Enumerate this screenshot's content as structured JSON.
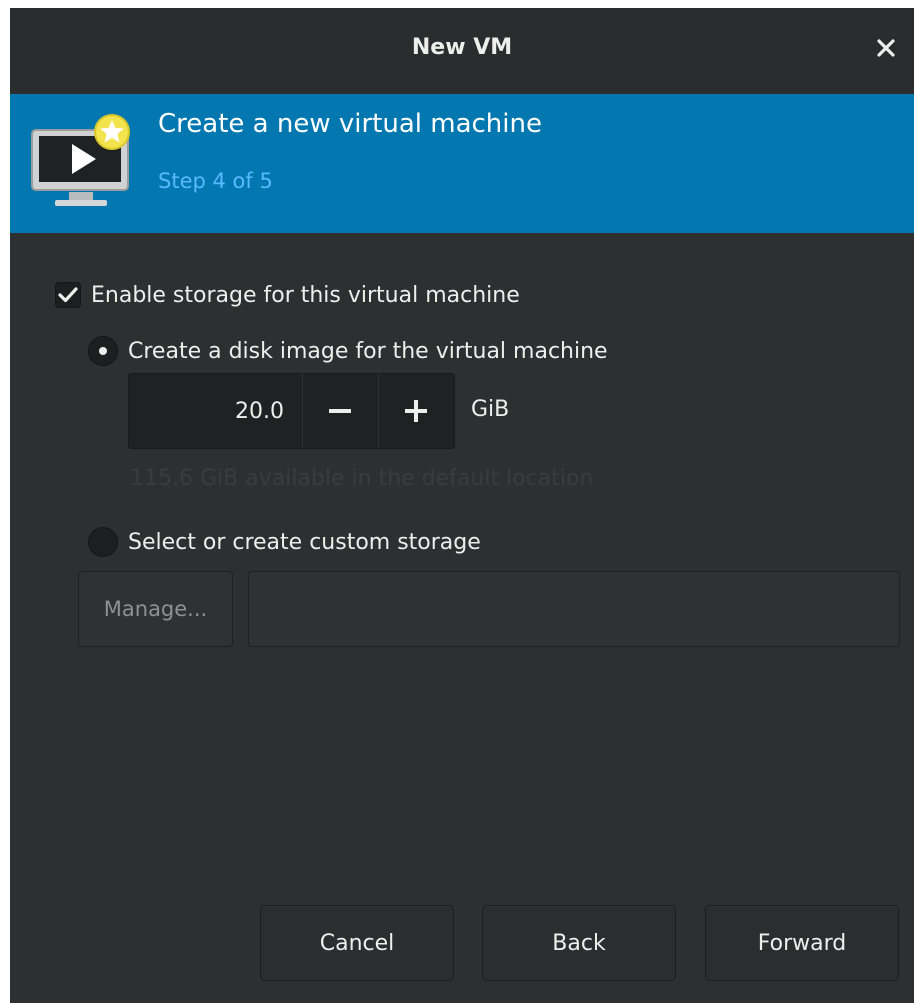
{
  "window": {
    "title": "New VM",
    "close_icon": "close-icon"
  },
  "banner": {
    "title": "Create a new virtual machine",
    "step": "Step 4 of 5",
    "icon": "vm-monitor-icon",
    "accent_color": "#0277b0"
  },
  "storage": {
    "enable_label": "Enable storage for this virtual machine",
    "enable_checked": true,
    "create_disk_label": "Create a disk image for the virtual machine",
    "create_disk_selected": true,
    "size_value": "20.0",
    "size_unit": "GiB",
    "available_text": "115.6 GiB available in the default location",
    "custom_label": "Select or create custom storage",
    "custom_selected": false,
    "manage_label": "Manage...",
    "path_value": ""
  },
  "footer": {
    "cancel_label": "Cancel",
    "back_label": "Back",
    "forward_label": "Forward"
  }
}
